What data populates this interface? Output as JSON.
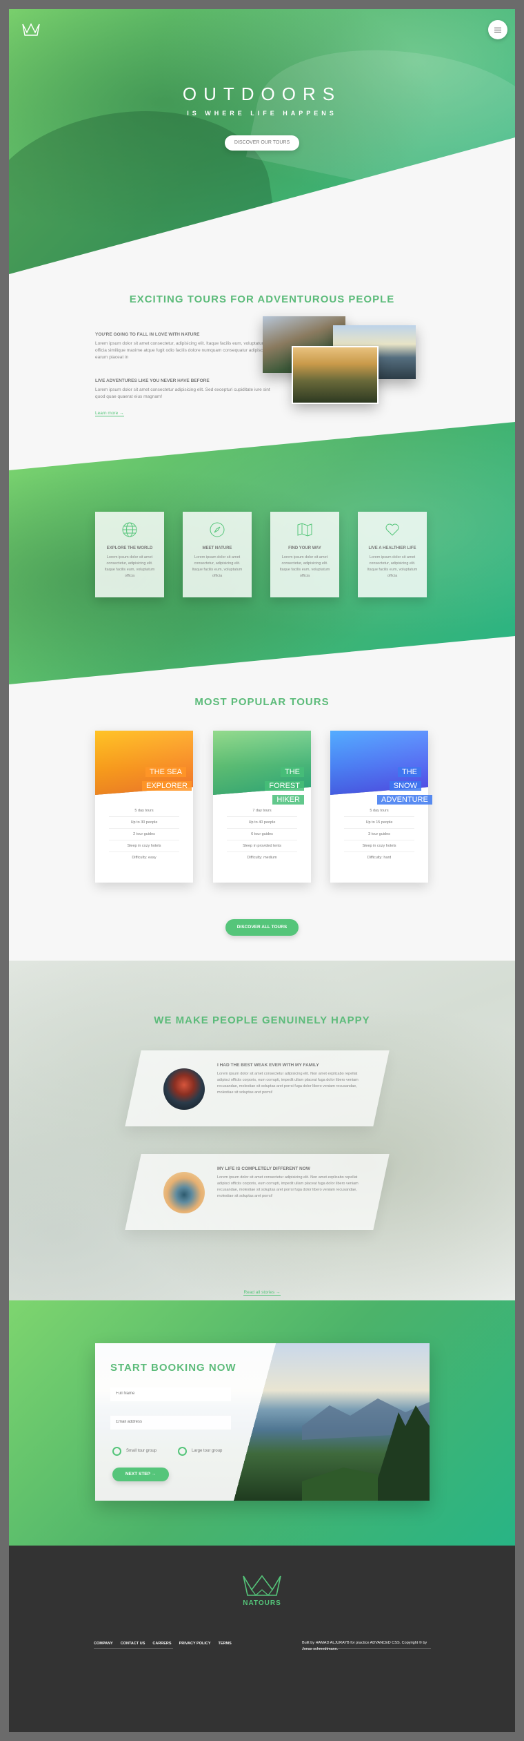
{
  "hero": {
    "title": "OUTDOORS",
    "subtitle": "IS WHERE LIFE HAPPENS",
    "cta": "DISCOVER OUR TOURS",
    "logo_icon": "crown-logo-icon",
    "menu_icon": "hamburger-menu-icon"
  },
  "about": {
    "title": "EXCITING TOURS FOR ADVENTUROUS PEOPLE",
    "h1": "YOU'RE GOING TO FALL IN LOVE WITH NATURE",
    "p1": "Lorem ipsum dolor sit amet consectetur, adipisicing elit. Itaque facilis eum, voluptatum officia similique maxime atque fugit odio facilis dolore numquam consequatur adipisci earum placeat in",
    "h2": "LIVE ADVENTURES LIKE YOU NEVER HAVE BEFORE",
    "p2": "Lorem ipsum dolor sit amet consectetur adipisicing elit. Sed excepturi cupiditate iure sint quod quae quaerat eius magnam!",
    "link": "Learn more →"
  },
  "features": [
    {
      "title": "EXPLORE THE WORLD",
      "text": "Lorem ipsum dolor sit amet consectetur, adipisicing elit. Itaque facilis eum, voluptatum officia",
      "icon": "globe-icon"
    },
    {
      "title": "MEET NATURE",
      "text": "Lorem ipsum dolor sit amet consectetur, adipisicing elit. Itaque facilis eum, voluptatum officia",
      "icon": "compass-icon"
    },
    {
      "title": "FIND YOUR WAY",
      "text": "Lorem ipsum dolor sit amet consectetur, adipisicing elit. Itaque facilis eum, voluptatum officia",
      "icon": "map-icon"
    },
    {
      "title": "LIVE A HEALTHIER LIFE",
      "text": "Lorem ipsum dolor sit amet consectetur, adipisicing elit. Itaque facilis eum, voluptatum officia",
      "icon": "heart-icon"
    }
  ],
  "tours": {
    "title": "MOST POPULAR TOURS",
    "cards": [
      {
        "line1": "THE SEA",
        "line2": "EXPLORER",
        "details": [
          "5 day tours",
          "Up to 30 people",
          "2 tour guides",
          "Sleep in cozy hotels",
          "Difficulty: easy"
        ],
        "color": "#ffb900"
      },
      {
        "line1": "THE FOREST",
        "line2": "HIKER",
        "details": [
          "7 day tours",
          "Up to 40 people",
          "6 tour guides",
          "Sleep in provided tents",
          "Difficulty: medium"
        ],
        "color": "#7ed56f"
      },
      {
        "line1": "THE SNOW",
        "line2": "ADVENTURE",
        "details": [
          "5 day tours",
          "Up to 15 people",
          "3 tour guides",
          "Sleep in cozy hotels",
          "Difficulty: hard"
        ],
        "color": "#2998ff"
      }
    ],
    "cta": "DISCOVER ALL TOURS"
  },
  "stories": {
    "title": "WE MAKE PEOPLE GENUINELY HAPPY",
    "items": [
      {
        "heading": "I HAD THE BEST WEAK EVER WITH MY FAMILY",
        "text": "Lorem ipsum dolor sit amet consectetur adipisicing elit. Non amet explicabo repellat adipisci officiis corporis, eum corrupti, impedit ullam placeat fuga dolor libero veniam recusandae, molestiae sit soluptas aret porrsi fuga dolor libero veniam recusandae, molestiae sit soluptas aret porrsi!"
      },
      {
        "heading": "MY LIFE IS COMPLETELY DIFFERENT NOW",
        "text": "Lorem ipsum dolor sit amet consectetur adipisicing elit. Non amet explicabo repellat adipisci officiis corporis, eum corrupti, impedit ullam placeat fuga dolor libero veniam recusandae, molestiae sit soluptas aret porrsi fuga dolor libero veniam recusandae, molestiae sit soluptas aret porrsi!"
      }
    ],
    "link": "Read all stories →"
  },
  "booking": {
    "title": "START BOOKING NOW",
    "name_placeholder": "Full Name",
    "email_placeholder": "Email address",
    "radio1": "Small tour group",
    "radio2": "Large tour group",
    "cta": "NEXT STEP →"
  },
  "footer": {
    "brand": "NATOURS",
    "nav": [
      "COMPANY",
      "CONTACT US",
      "CARRERS",
      "PRIVACY POLICY",
      "TERMS"
    ],
    "copyright": "Built by HAMAD ALJURAYB for practice ADVANCED CSS. Copyright © by Jonas schmedtmann."
  }
}
